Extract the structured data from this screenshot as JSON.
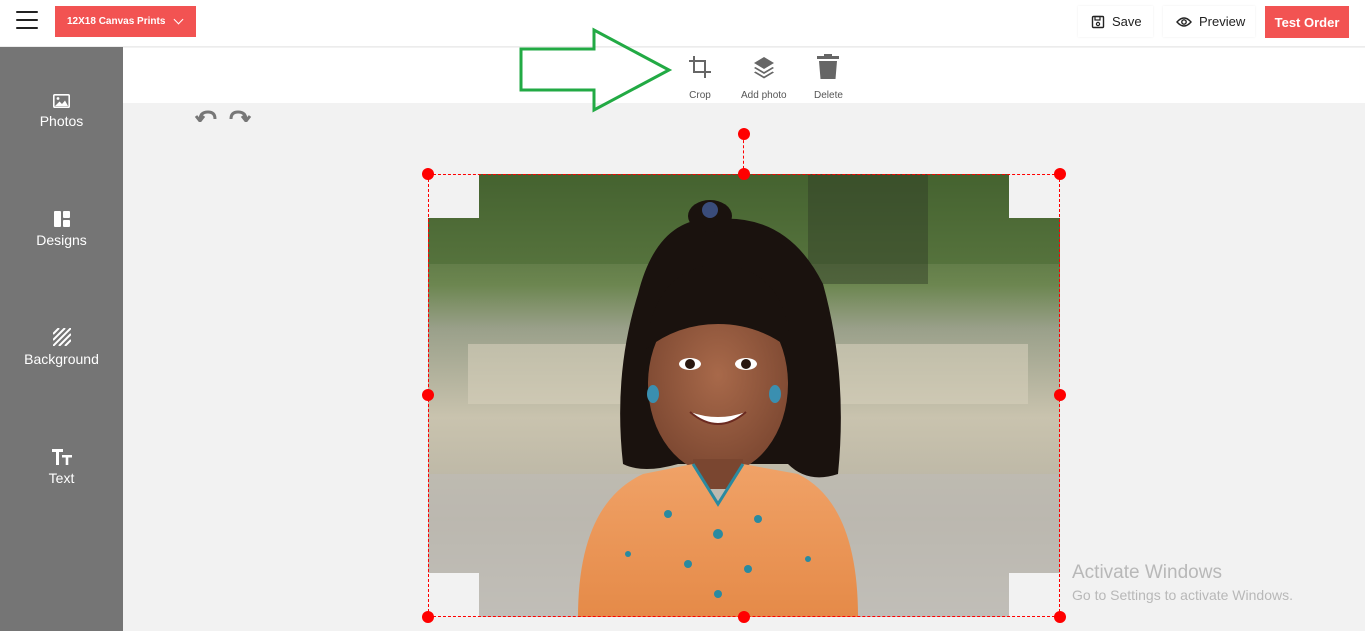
{
  "header": {
    "product_select_label": "12X18 Canvas Prints",
    "save_label": "Save",
    "preview_label": "Preview",
    "test_order_label": "Test Order"
  },
  "sidebar": {
    "items": [
      {
        "label": "Photos",
        "icon": "image-icon"
      },
      {
        "label": "Designs",
        "icon": "layout-icon"
      },
      {
        "label": "Background",
        "icon": "hatch-icon"
      },
      {
        "label": "Text",
        "icon": "text-icon"
      }
    ]
  },
  "toolbar": {
    "crop_label": "Crop",
    "add_photo_label": "Add photo",
    "delete_label": "Delete"
  },
  "watermark": {
    "title": "Activate Windows",
    "subtitle": "Go to Settings to activate Windows."
  },
  "colors": {
    "accent": "#f25352",
    "sidebar": "#757575",
    "selection": "#ff0000",
    "annotation_arrow": "#22aa44"
  }
}
